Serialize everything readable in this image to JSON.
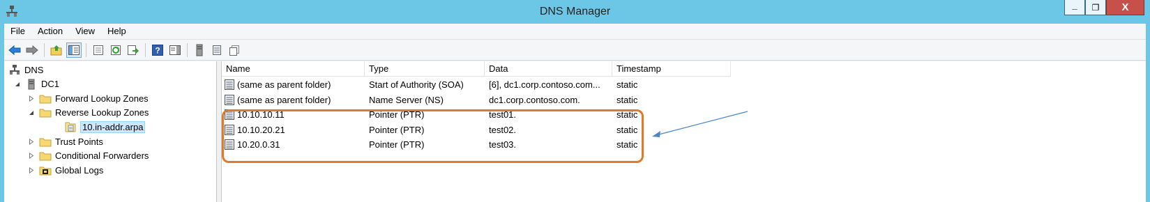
{
  "window": {
    "title": "DNS Manager",
    "minimize": "_",
    "restore": "❐",
    "close": "X"
  },
  "menu": [
    "File",
    "Action",
    "View",
    "Help"
  ],
  "toolbar": [
    "back-icon",
    "forward-icon",
    "up-folder-icon",
    "show-hide-tree-icon",
    "properties-icon",
    "refresh-icon",
    "export-list-icon",
    "help-icon",
    "show-hide-action-pane-icon",
    "server-icon",
    "zone-list-icon",
    "record-icon"
  ],
  "tree": {
    "items": [
      {
        "label": "DNS",
        "level": 0,
        "expander": "",
        "icon": "dns-icon"
      },
      {
        "label": "DC1",
        "level": 1,
        "expander": "expanded",
        "icon": "server-icon"
      },
      {
        "label": "Forward Lookup Zones",
        "level": 2,
        "expander": "collapsed",
        "icon": "folder-icon"
      },
      {
        "label": "Reverse Lookup Zones",
        "level": 2,
        "expander": "expanded",
        "icon": "folder-icon"
      },
      {
        "label": "10.in-addr.arpa",
        "level": 3,
        "expander": "",
        "icon": "zone-icon",
        "selected": true
      },
      {
        "label": "Trust Points",
        "level": 2,
        "expander": "collapsed",
        "icon": "folder-icon"
      },
      {
        "label": "Conditional Forwarders",
        "level": 2,
        "expander": "collapsed",
        "icon": "folder-icon"
      },
      {
        "label": "Global Logs",
        "level": 2,
        "expander": "collapsed",
        "icon": "log-icon"
      }
    ]
  },
  "list": {
    "columns": [
      "Name",
      "Type",
      "Data",
      "Timestamp"
    ],
    "rows": [
      {
        "name": "(same as parent folder)",
        "type": "Start of Authority (SOA)",
        "data": "[6], dc1.corp.contoso.com...",
        "timestamp": "static"
      },
      {
        "name": "(same as parent folder)",
        "type": "Name Server (NS)",
        "data": "dc1.corp.contoso.com.",
        "timestamp": "static"
      },
      {
        "name": "10.10.10.11",
        "type": "Pointer (PTR)",
        "data": "test01.",
        "timestamp": "static"
      },
      {
        "name": "10.10.20.21",
        "type": "Pointer (PTR)",
        "data": "test02.",
        "timestamp": "static"
      },
      {
        "name": "10.20.0.31",
        "type": "Pointer (PTR)",
        "data": "test03.",
        "timestamp": "static"
      }
    ]
  },
  "colors": {
    "titlebar": "#6cc7e6",
    "highlight_box": "#e07a29",
    "arrow": "#4a86c8",
    "selection": "#cce8ff"
  }
}
